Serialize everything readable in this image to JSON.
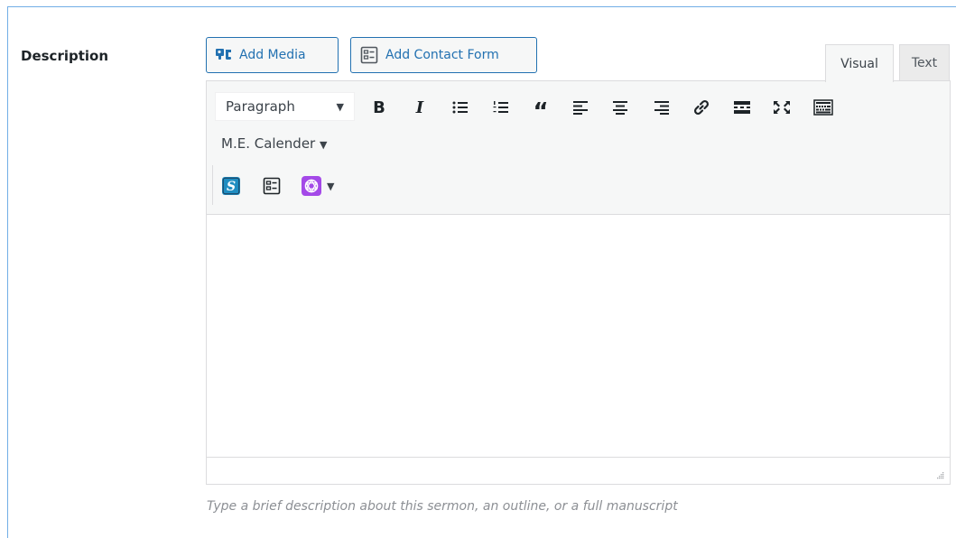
{
  "field": {
    "label": "Description",
    "description": "Type a brief description about this sermon, an outline, or a full manuscript"
  },
  "media_buttons": {
    "add_media": {
      "label": "Add Media",
      "icon": "media-icon"
    },
    "add_contact_form": {
      "label": "Add Contact Form",
      "icon": "form-icon"
    }
  },
  "editor_tabs": [
    {
      "label": "Visual",
      "active": true
    },
    {
      "label": "Text",
      "active": false
    }
  ],
  "toolbar": {
    "format_select": {
      "value": "Paragraph"
    },
    "buttons": [
      "bold-icon",
      "italic-icon",
      "bullet-list-icon",
      "numbered-list-icon",
      "blockquote-icon",
      "align-left-icon",
      "align-center-icon",
      "align-right-icon",
      "link-icon",
      "read-more-icon",
      "fullscreen-icon",
      "toolbar-toggle-icon"
    ],
    "bold_glyph": "B",
    "italic_glyph": "I",
    "quote_glyph": "“",
    "plugin_menu": {
      "label": "M.E. Calender",
      "caret": "▼"
    },
    "row3_buttons": [
      "s-plugin-icon",
      "form-icon",
      "purple-plugin-icon"
    ],
    "caret": "▼"
  },
  "colors": {
    "accent": "#2271b1",
    "focus_border": "#72aee6",
    "plugin_blue": "#1f8dc1",
    "plugin_purple": "#a449e8"
  }
}
